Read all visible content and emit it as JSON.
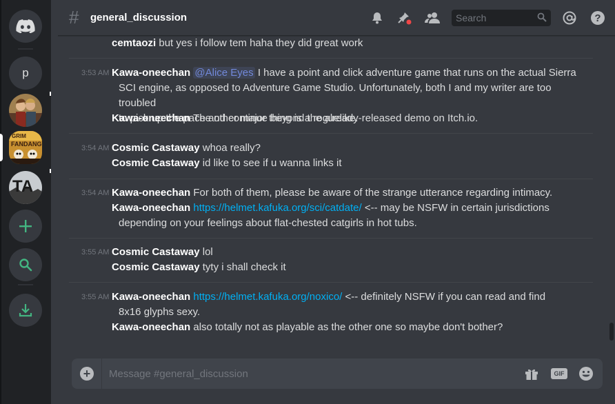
{
  "server_rail": {
    "home_icon": "discord-logo-icon",
    "server_p_label": "p",
    "servers": [
      {
        "icon": "server-avatar-people"
      },
      {
        "icon": "server-avatar-grim-fandango"
      },
      {
        "icon": "server-avatar-ta"
      }
    ],
    "add_server_icon": "plus-icon",
    "explore_icon": "search-icon",
    "download_icon": "download-icon"
  },
  "header": {
    "channel_name": "general_discussion",
    "search_placeholder": "Search",
    "icons": [
      "bell-icon",
      "pin-icon",
      "members-icon",
      "mention-icon",
      "help-icon"
    ]
  },
  "messages": [
    {
      "time": "",
      "lines": [
        {
          "user": "cemtaozi",
          "text": "but yes i follow tem haha they did great work"
        }
      ]
    },
    {
      "time": "3:53 AM",
      "lines": [
        {
          "user": "Kawa-oneechan",
          "mention": "@Alice Eyes",
          "text": "I have a point and click adventure game that runs on the actual Sierra",
          "cont": [
            "SCI engine, as opposed to Adventure Game Studio. Unfortunately, both I and my writer are too troubled",
            "to pick up the pace and continue beyond the already-released demo on Itch.io."
          ]
        },
        {
          "user": "Kawa-oneechan",
          "text": "The other major thing is a roguelike."
        }
      ]
    },
    {
      "time": "3:54 AM",
      "lines": [
        {
          "user": "Cosmic Castaway",
          "text": "whoa really?"
        },
        {
          "user": "Cosmic Castaway",
          "text": "id like to see if u wanna links it"
        }
      ]
    },
    {
      "time": "3:54 AM",
      "lines": [
        {
          "user": "Kawa-oneechan",
          "text": "For both of them, please be aware of the strange utterance regarding intimacy."
        },
        {
          "user": "Kawa-oneechan",
          "link": "https://helmet.kafuka.org/sci/catdate/",
          "text": "<-- may be NSFW in certain jurisdictions",
          "cont": [
            "depending on your feelings about flat-chested catgirls in hot tubs."
          ]
        }
      ]
    },
    {
      "time": "3:55 AM",
      "lines": [
        {
          "user": "Cosmic Castaway",
          "text": "lol"
        },
        {
          "user": "Cosmic Castaway",
          "text": "tyty i shall check it"
        }
      ]
    },
    {
      "time": "3:55 AM",
      "lines": [
        {
          "user": "Kawa-oneechan",
          "link": "https://helmet.kafuka.org/noxico/",
          "text": "<-- definitely NSFW if you can read and find",
          "cont": [
            "8x16 glyphs sexy."
          ]
        },
        {
          "user": "Kawa-oneechan",
          "text": "also totally not as playable as the other one so maybe don't bother?"
        }
      ]
    }
  ],
  "composer": {
    "placeholder": "Message #general_discussion",
    "icons": [
      "gift-icon",
      "gif-icon",
      "emoji-icon"
    ],
    "gif_label": "GIF"
  },
  "colors": {
    "accent": "#7289da",
    "link": "#00b0f4",
    "green": "#43b581"
  }
}
